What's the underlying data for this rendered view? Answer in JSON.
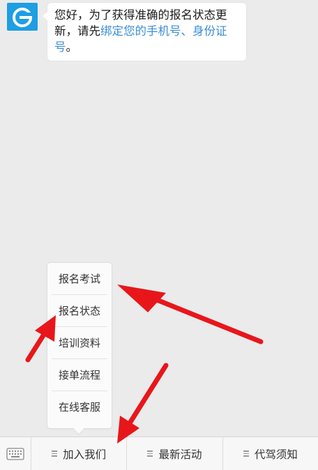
{
  "chat": {
    "message_text": "您好，为了获得准确的报名状态更新，请先",
    "message_link": "绑定您的手机号、身份证号",
    "message_end": "。"
  },
  "menu": {
    "items": [
      "报名考试",
      "报名状态",
      "培训资料",
      "接单流程",
      "在线客服"
    ]
  },
  "bottom_bar": {
    "tabs": [
      "加入我们",
      "最新活动",
      "代驾须知"
    ]
  },
  "colors": {
    "avatar": "#1e9ee3",
    "link": "#3a8ed5",
    "arrow": "#e8161b"
  },
  "icons": {
    "avatar": "e-logo-icon",
    "keyboard": "keyboard-icon",
    "tab_menu": "menu-lines-icon"
  }
}
